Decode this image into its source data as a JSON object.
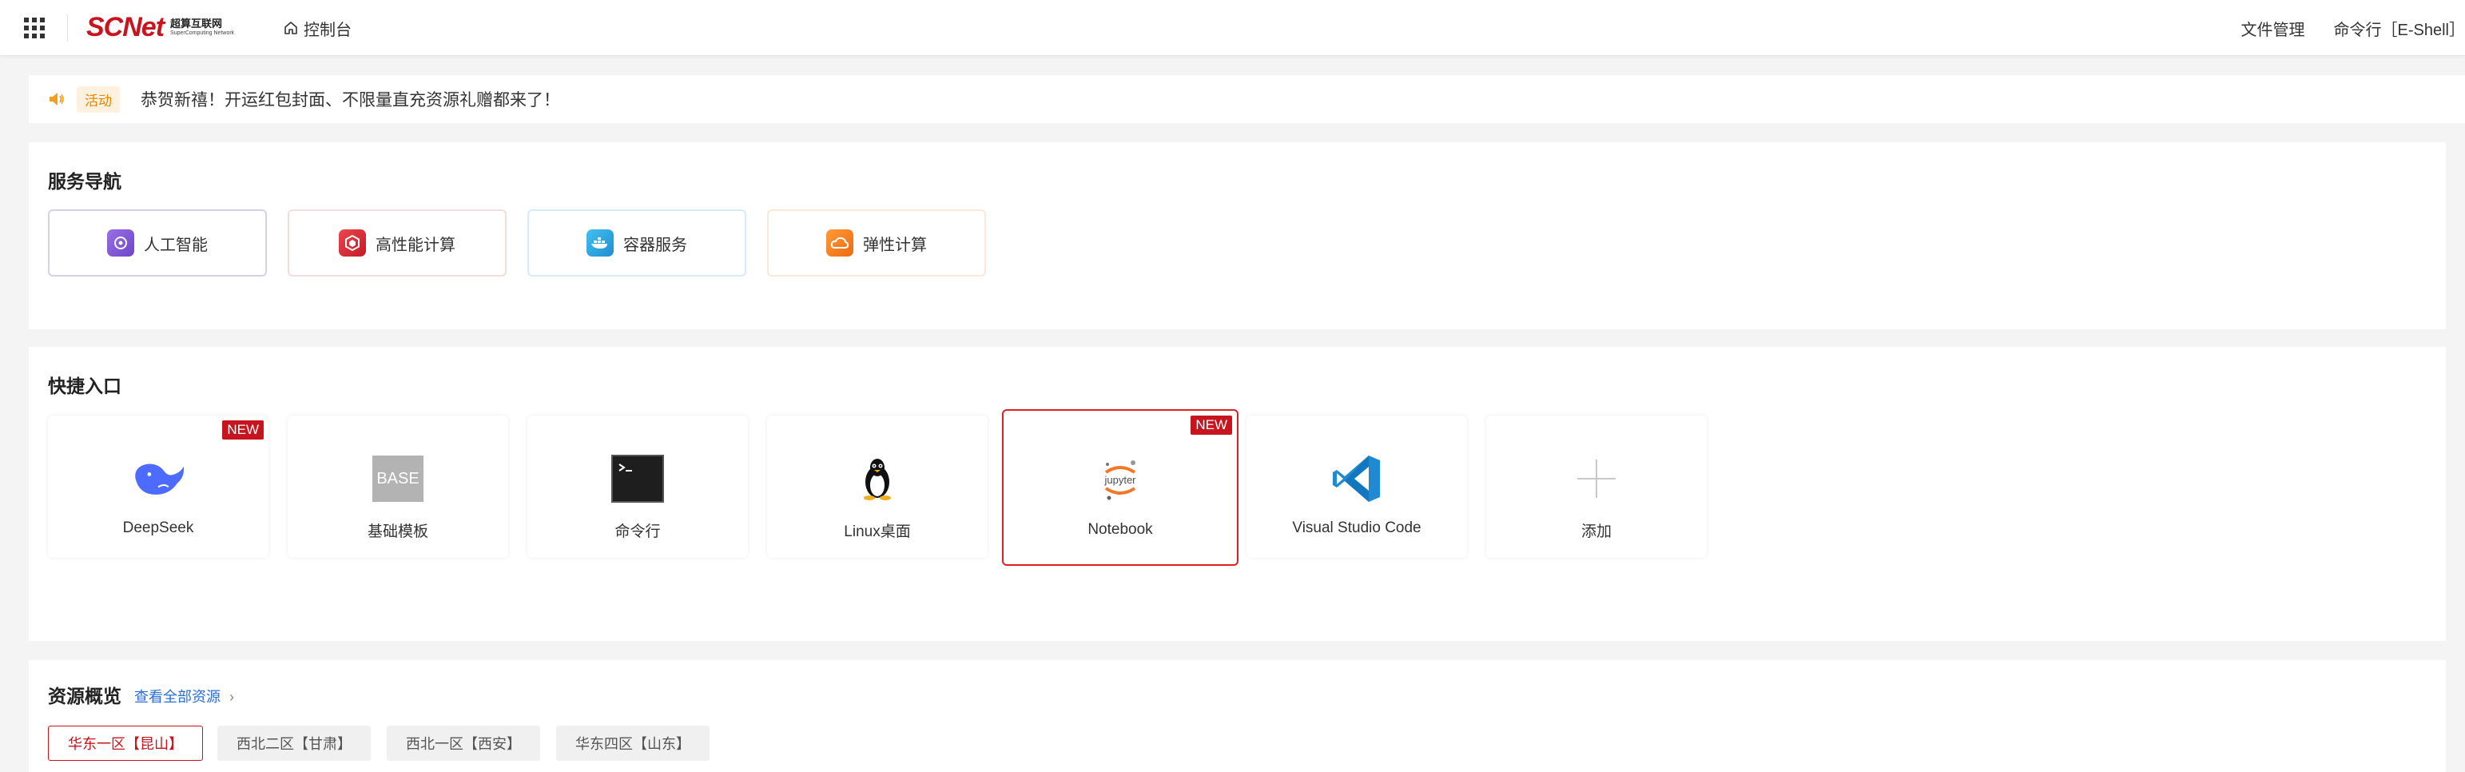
{
  "header": {
    "logo_main": "SCNet",
    "logo_cn": "超算互联网",
    "logo_en": "SuperComputing Network",
    "console": "控制台",
    "right_links": [
      "文件管理",
      "命令行［E-Shell］"
    ]
  },
  "notice": {
    "tag": "活动",
    "message": "恭贺新禧！开运红包封面、不限量直充资源礼赠都来了！"
  },
  "service_nav": {
    "title": "服务导航",
    "items": [
      {
        "label": "人工智能",
        "icon": "ai-icon",
        "color": "#8a5ad8"
      },
      {
        "label": "高性能计算",
        "icon": "hpc-icon",
        "color": "#d8303a"
      },
      {
        "label": "容器服务",
        "icon": "container-icon",
        "color": "#2aa6e0"
      },
      {
        "label": "弹性计算",
        "icon": "cloud-icon",
        "color": "#f07a1a"
      }
    ]
  },
  "quick": {
    "title": "快捷入口",
    "new_badge": "NEW",
    "base_text": "BASE",
    "jupyter_text": "jupyter",
    "items": [
      {
        "label": "DeepSeek",
        "icon": "deepseek-icon"
      },
      {
        "label": "基础模板",
        "icon": "base-icon"
      },
      {
        "label": "命令行",
        "icon": "terminal-icon"
      },
      {
        "label": "Linux桌面",
        "icon": "linux-penguin-icon"
      },
      {
        "label": "Notebook",
        "icon": "jupyter-icon"
      },
      {
        "label": "Visual Studio Code",
        "icon": "vscode-icon"
      },
      {
        "label": "添加",
        "icon": "plus-icon"
      }
    ]
  },
  "resources": {
    "title": "资源概览",
    "link": "查看全部资源",
    "regions": [
      "华东一区【昆山】",
      "西北二区【甘肃】",
      "西北一区【西安】",
      "华东四区【山东】"
    ],
    "active_region": "华东一区【昆山】"
  },
  "colors": {
    "brand": "#c8141e",
    "link": "#2a6fd6"
  }
}
